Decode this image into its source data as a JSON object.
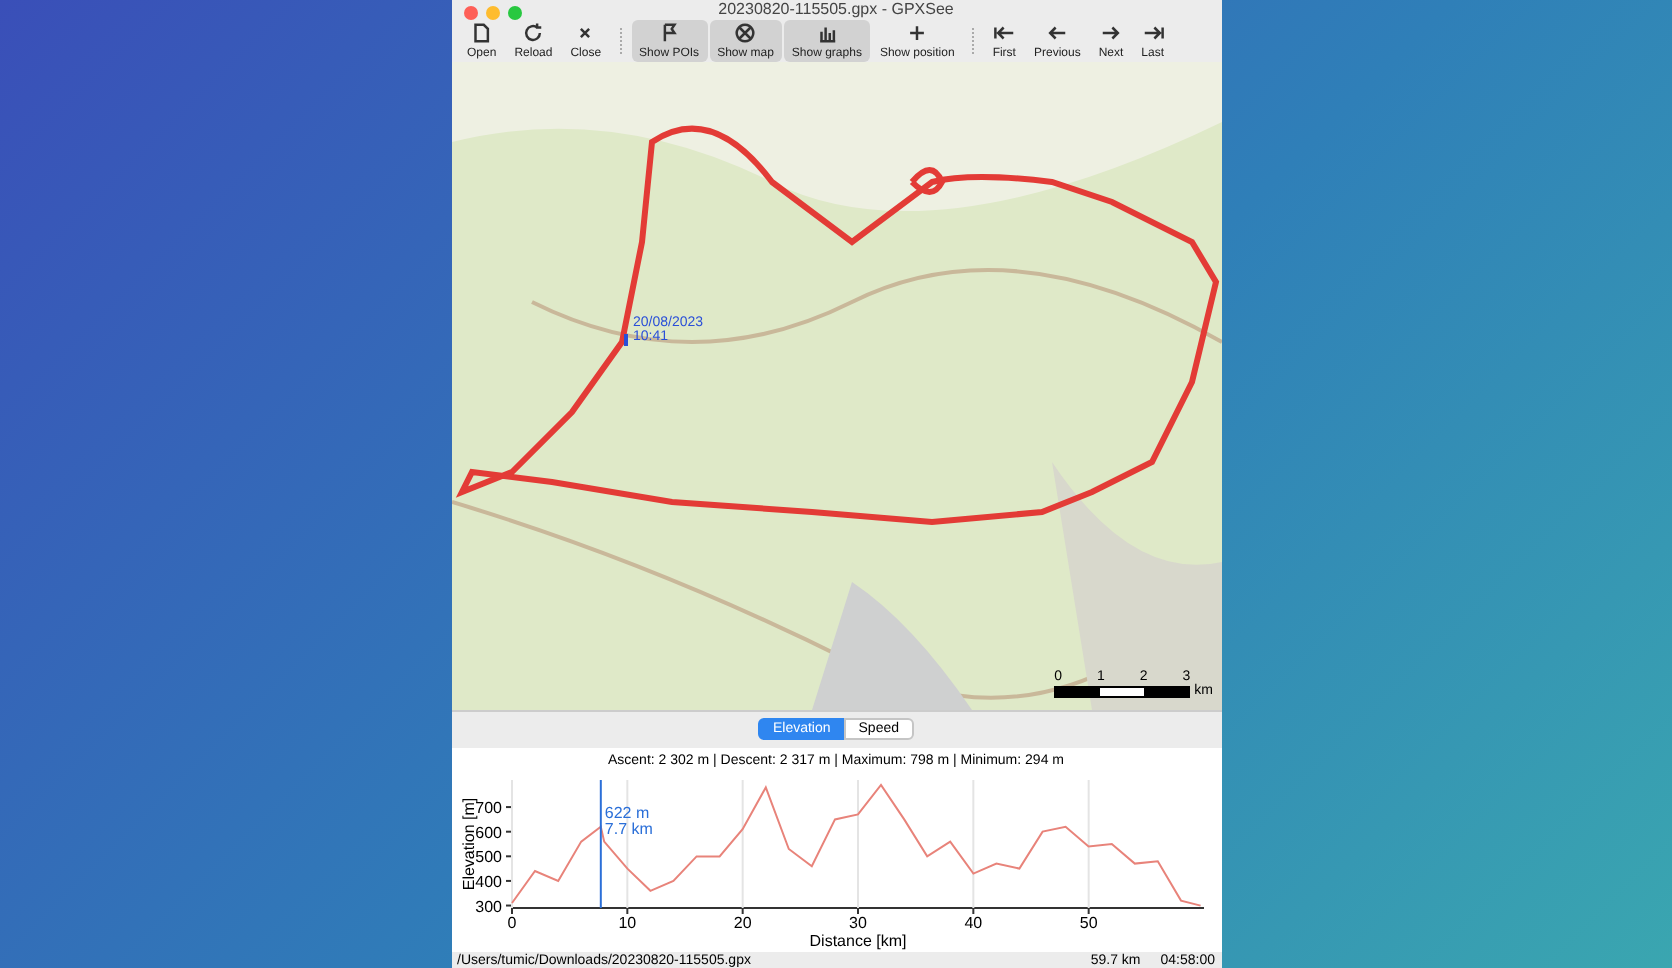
{
  "window": {
    "title": "20230820-115505.gpx - GPXSee"
  },
  "toolbar": {
    "groups": [
      [
        {
          "label": "Open",
          "selected": false
        },
        {
          "label": "Reload",
          "selected": false
        },
        {
          "label": "Close",
          "selected": false
        }
      ],
      [
        {
          "label": "Show POIs",
          "selected": true
        },
        {
          "label": "Show map",
          "selected": true
        },
        {
          "label": "Show graphs",
          "selected": true
        },
        {
          "label": "Show position",
          "selected": false
        }
      ],
      [
        {
          "label": "First",
          "selected": false
        },
        {
          "label": "Previous",
          "selected": false
        },
        {
          "label": "Next",
          "selected": false
        },
        {
          "label": "Last",
          "selected": false
        }
      ]
    ]
  },
  "map": {
    "position_label": [
      "20/08/2023",
      "10:41"
    ],
    "scale": {
      "ticks": [
        "0",
        "1",
        "2",
        "3"
      ],
      "unit": "km"
    }
  },
  "graph": {
    "tabs": [
      {
        "label": "Elevation",
        "selected": true
      },
      {
        "label": "Speed",
        "selected": false
      }
    ],
    "summary": "Ascent: 2 302 m | Descent: 2 317 m | Maximum: 798 m | Minimum: 294 m",
    "chart_data": {
      "type": "line",
      "xlabel": "Distance [km]",
      "ylabel": "Elevation [m]",
      "xlim": [
        0,
        60
      ],
      "ylim": [
        290,
        810
      ],
      "xticks": [
        0,
        10,
        20,
        30,
        40,
        50
      ],
      "yticks": [
        300,
        400,
        500,
        600,
        700
      ],
      "grid": true,
      "x": [
        0,
        2,
        4,
        6,
        7.7,
        8,
        10,
        12,
        14,
        16,
        18,
        20,
        22,
        24,
        26,
        28,
        30,
        32,
        34,
        36,
        38,
        40,
        42,
        44,
        46,
        48,
        50,
        52,
        54,
        56,
        58,
        59.7
      ],
      "values": [
        310,
        440,
        400,
        560,
        620,
        560,
        450,
        360,
        400,
        500,
        500,
        610,
        780,
        530,
        460,
        650,
        670,
        790,
        650,
        500,
        560,
        430,
        470,
        450,
        600,
        620,
        540,
        550,
        470,
        480,
        320,
        300
      ],
      "ref_lines": [
        {
          "axis": "x",
          "value": 7.7,
          "color": "#2b6fd8"
        }
      ],
      "annotations": [
        {
          "x": 7.7,
          "y": 622,
          "text": "622 m"
        },
        {
          "x": 7.7,
          "y": 622,
          "text": "7.7 km"
        }
      ]
    }
  },
  "status_bar": {
    "path": "/Users/tumic/Downloads/20230820-115505.gpx",
    "distance": "59.7 km",
    "time": "04:58:00"
  }
}
